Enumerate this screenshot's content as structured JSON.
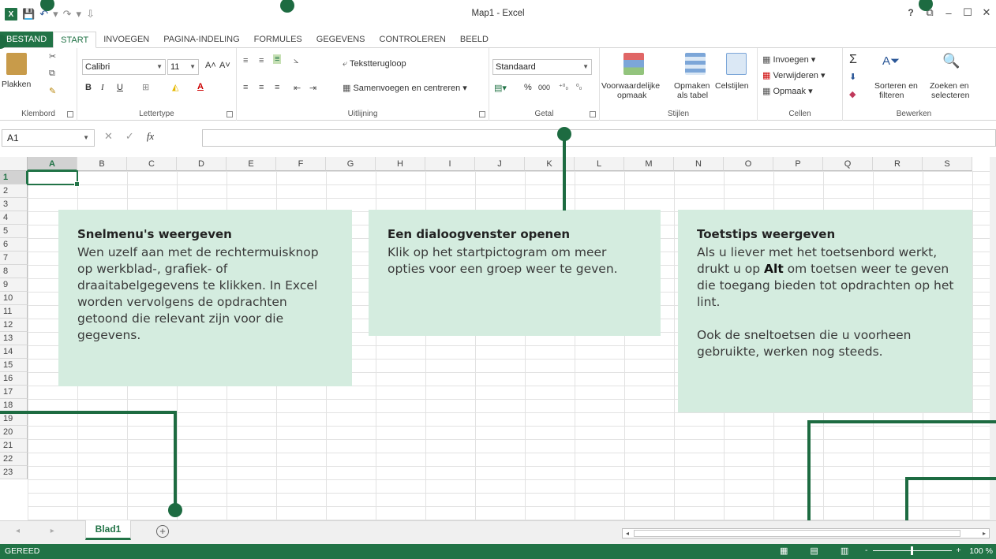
{
  "window": {
    "title": "Map1 - Excel",
    "help": "?",
    "ribbon_display": "⧉",
    "minimize": "–",
    "maximize": "☐",
    "close": "✕"
  },
  "qat": {
    "logo": "X",
    "save": "💾",
    "undo": "↶",
    "undo_dd": "▾",
    "redo": "↷",
    "redo_dd": "▾",
    "customize": "⇩"
  },
  "tabs": [
    "BESTAND",
    "START",
    "INVOEGEN",
    "PAGINA-INDELING",
    "FORMULES",
    "GEGEVENS",
    "CONTROLEREN",
    "BEELD"
  ],
  "ribbon": {
    "clipboard": {
      "label": "Klembord",
      "paste": "Plakken"
    },
    "font": {
      "label": "Lettertype",
      "name": "Calibri",
      "size": "11",
      "bold": "B",
      "italic": "I",
      "underline": "U",
      "grow": "A˄",
      "shrink": "A˅"
    },
    "alignment": {
      "label": "Uitlijning",
      "wrap": "Tekstterugloop",
      "merge": "Samenvoegen en centreren"
    },
    "number": {
      "label": "Getal",
      "format": "Standaard",
      "percent": "%",
      "thousands": "000",
      "inc_dec": "⁺⁰₀",
      "dec_dec": "⁰₀"
    },
    "styles": {
      "label": "Stijlen",
      "conditional_1": "Voorwaardelijke",
      "conditional_2": "opmaak",
      "table_1": "Opmaken",
      "table_2": "als tabel",
      "cell_styles": "Celstijlen"
    },
    "cells": {
      "label": "Cellen",
      "insert": "Invoegen",
      "delete": "Verwijderen",
      "format": "Opmaak"
    },
    "editing": {
      "label": "Bewerken",
      "sort_1": "Sorteren en",
      "sort_2": "filteren",
      "find_1": "Zoeken en",
      "find_2": "selecteren"
    }
  },
  "formula_bar": {
    "name_box": "A1",
    "cancel": "✕",
    "enter": "✓",
    "fx": "fx",
    "value": ""
  },
  "columns": [
    "A",
    "B",
    "C",
    "D",
    "E",
    "F",
    "G",
    "H",
    "I",
    "J",
    "K",
    "L",
    "M",
    "N",
    "O",
    "P",
    "Q",
    "R",
    "S"
  ],
  "rows": [
    "1",
    "2",
    "3",
    "4",
    "5",
    "6",
    "7",
    "8",
    "9",
    "10",
    "11",
    "12",
    "13",
    "14",
    "15",
    "16",
    "17",
    "18",
    "19",
    "20",
    "21",
    "22",
    "23"
  ],
  "callouts": {
    "context_menu": {
      "title": "Snelmenu's weergeven",
      "body": "Wen uzelf aan met de rechtermuisknop op werkblad-, grafiek- of draaitabelgegevens te klikken. In Excel worden vervolgens de opdrachten getoond die relevant zijn voor die gegevens."
    },
    "dialog": {
      "title": "Een dialoogvenster openen",
      "body": "Klik op het startpictogram om meer opties voor een groep weer te geven."
    },
    "keytips": {
      "title": "Toetstips weergeven",
      "body_before": "Als u liever met het toetsenbord werkt, drukt u op ",
      "key": "Alt",
      "body_after": " om toetsen weer te geven die toegang bieden tot opdrachten op het lint.",
      "body2": "Ook de sneltoetsen die u voorheen gebruikte, werken nog steeds."
    }
  },
  "sheets": {
    "nav": "◂ ▸",
    "active": "Blad1",
    "add": "+"
  },
  "status": {
    "ready": "GEREED",
    "view_normal": "▦",
    "view_layout": "▤",
    "view_break": "▥",
    "zoom_minus": "-",
    "zoom_plus": "+",
    "zoom": "100 %"
  },
  "colors": {
    "excel_green": "#217346",
    "callout_bg": "#d4ecdf",
    "callout_line": "#1d6b41"
  }
}
